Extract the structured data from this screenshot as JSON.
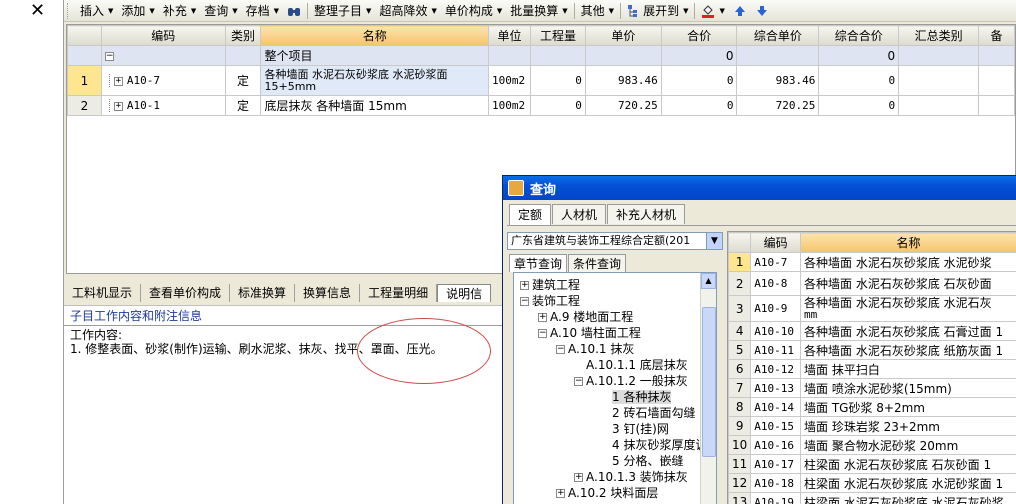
{
  "toolbar": {
    "close": "✕",
    "items": [
      "插入",
      "添加",
      "补充",
      "查询",
      "存档"
    ],
    "items2": [
      "整理子目",
      "超高降效",
      "单价构成",
      "批量换算"
    ],
    "other": "其他",
    "expand": "展开到"
  },
  "grid": {
    "headers": [
      "编码",
      "类别",
      "名称",
      "单位",
      "工程量",
      "单价",
      "合价",
      "综合单价",
      "综合合价",
      "汇总类别",
      "备"
    ],
    "group_row": {
      "minus": "−",
      "name": "整个项目",
      "total": "0",
      "comp_total": "0"
    },
    "rows": [
      {
        "num": "1",
        "code": "A10-7",
        "type": "定",
        "name": "各种墙面 水泥石灰砂浆底 水泥砂浆面 15+5mm",
        "unit": "100m2",
        "qty": "0",
        "price": "983.46",
        "total": "0",
        "comp_price": "983.46",
        "comp_total": "0"
      },
      {
        "num": "2",
        "code": "A10-1",
        "type": "定",
        "name": "底层抹灰 各种墙面 15mm",
        "unit": "100m2",
        "qty": "0",
        "price": "720.25",
        "total": "0",
        "comp_price": "720.25",
        "comp_total": "0"
      }
    ]
  },
  "bottom": {
    "tabs": [
      "工料机显示",
      "查看单价构成",
      "标准换算",
      "换算信息",
      "工程量明细",
      "说明信"
    ],
    "title": "子目工作内容和附注信息",
    "line1": "工作内容:",
    "line2": "1. 修整表面、砂浆(制作)运输、刷水泥浆、抹灰、找平、罩面、压光。"
  },
  "dialog": {
    "title": "查询",
    "tabs": [
      "定额",
      "人材机",
      "补充人材机"
    ],
    "select_value": "广东省建筑与装饰工程综合定额(201",
    "sub_tabs": [
      "章节查询",
      "条件查询"
    ],
    "tree": [
      {
        "label": "建筑工程",
        "box": "+"
      },
      {
        "label": "装饰工程",
        "box": "−"
      },
      {
        "label": "A.9 楼地面工程",
        "box": "+"
      },
      {
        "label": "A.10 墙柱面工程",
        "box": "−"
      },
      {
        "label": "A.10.1 抹灰",
        "box": "−"
      },
      {
        "label": "A.10.1.1 底层抹灰",
        "box": ""
      },
      {
        "label": "A.10.1.2 一般抹灰",
        "box": "−"
      },
      {
        "label": "1 各种抹灰",
        "box": ""
      },
      {
        "label": "2 砖石墙面勾缝",
        "box": ""
      },
      {
        "label": "3 钉(挂)网",
        "box": ""
      },
      {
        "label": "4 抹灰砂浆厚度调",
        "box": ""
      },
      {
        "label": "5 分格、嵌缝",
        "box": ""
      },
      {
        "label": "A.10.1.3 装饰抹灰",
        "box": "+"
      },
      {
        "label": "A.10.2 块料面层",
        "box": "+"
      }
    ],
    "grid_headers": [
      "编码",
      "名称"
    ],
    "grid_rows": [
      {
        "num": "1",
        "code": "A10-7",
        "name": "各种墙面 水泥石灰砂浆底 水泥砂浆"
      },
      {
        "num": "2",
        "code": "A10-8",
        "name": "各种墙面 水泥石灰砂浆底 石灰砂面"
      },
      {
        "num": "3",
        "code": "A10-9",
        "name": "各种墙面 水泥石灰砂浆底 水泥石灰",
        "name2": "mm"
      },
      {
        "num": "4",
        "code": "A10-10",
        "name": "各种墙面 水泥石灰砂浆底 石膏过面 1"
      },
      {
        "num": "5",
        "code": "A10-11",
        "name": "各种墙面 水泥石灰砂浆底 纸筋灰面 1"
      },
      {
        "num": "6",
        "code": "A10-12",
        "name": "墙面 抹平扫白"
      },
      {
        "num": "7",
        "code": "A10-13",
        "name": "墙面 喷涂水泥砂浆(15mm)"
      },
      {
        "num": "8",
        "code": "A10-14",
        "name": "墙面 TG砂浆 8+2mm"
      },
      {
        "num": "9",
        "code": "A10-15",
        "name": "墙面 珍珠岩浆 23+2mm"
      },
      {
        "num": "10",
        "code": "A10-16",
        "name": "墙面 聚合物水泥砂浆 20mm"
      },
      {
        "num": "11",
        "code": "A10-17",
        "name": "柱梁面 水泥石灰砂浆底 石灰砂面 1"
      },
      {
        "num": "12",
        "code": "A10-18",
        "name": "柱梁面 水泥石灰砂浆底 水泥砂浆面 1"
      },
      {
        "num": "13",
        "code": "A10-19",
        "name": "柱梁面 水泥石灰砂浆底 水泥石灰砂浆"
      }
    ]
  }
}
